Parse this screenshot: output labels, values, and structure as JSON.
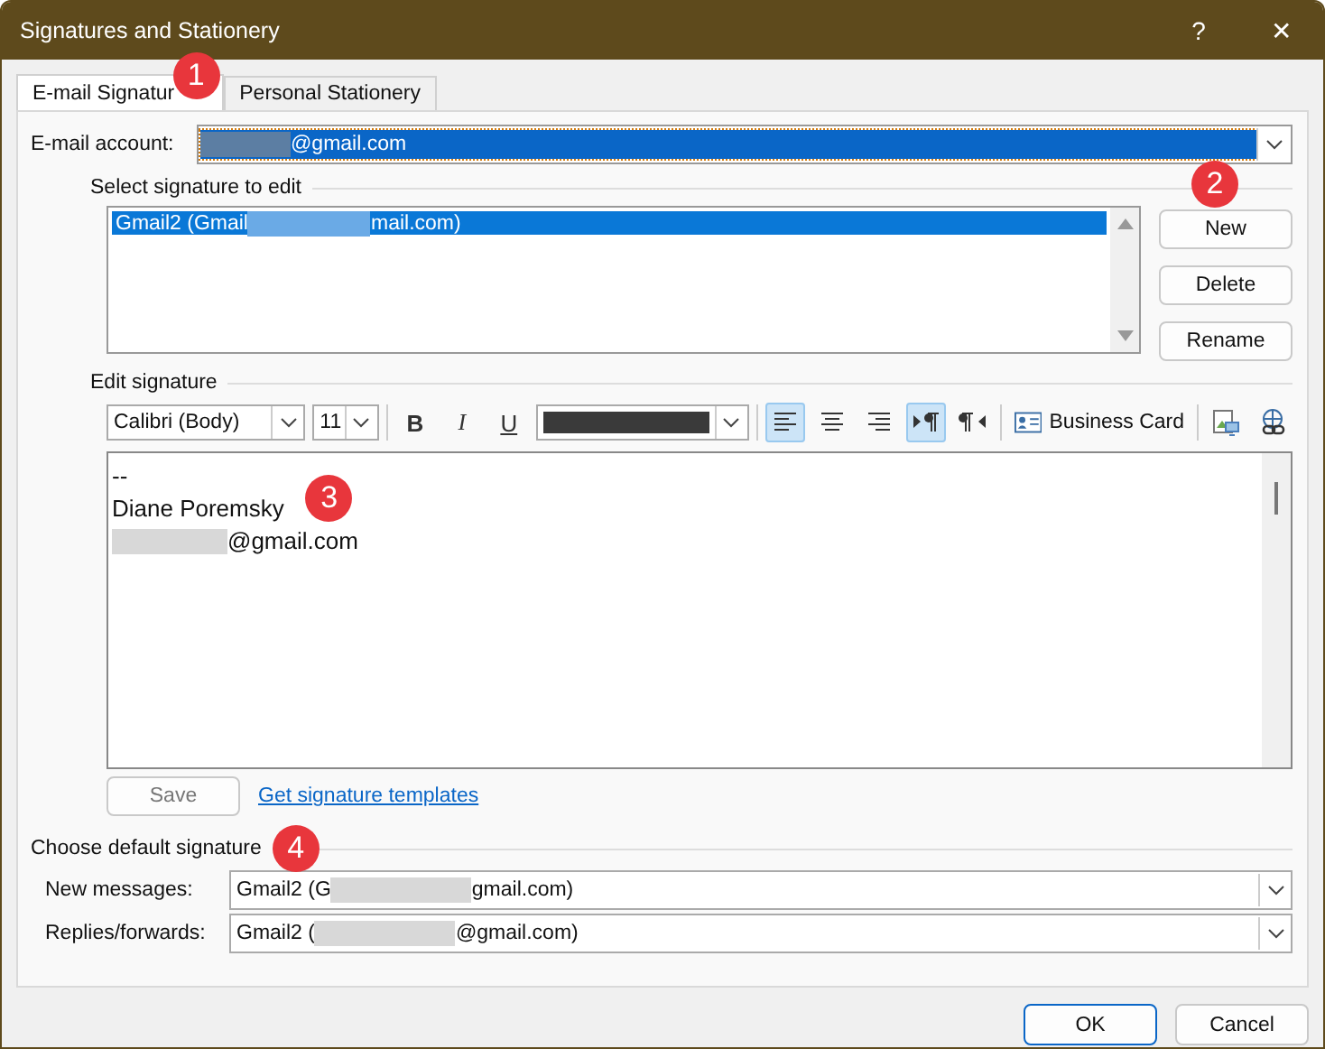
{
  "window": {
    "title": "Signatures and Stationery",
    "controls": [
      "?",
      "✕"
    ]
  },
  "tabs": [
    {
      "label": "E-mail Signatur",
      "selected": true
    },
    {
      "label": "Personal Stationery",
      "selected": false
    }
  ],
  "email_account": {
    "label": "E-mail account:",
    "value_after_redaction": "@gmail.com",
    "focused": true
  },
  "select_signature": {
    "heading": "Select signature to edit",
    "items": [
      {
        "before": "Gmail2 (Gmail",
        "after": "mail.com)",
        "selected": true
      }
    ],
    "buttons": [
      {
        "label": "New",
        "disabled": false
      },
      {
        "label": "Delete",
        "disabled": false
      },
      {
        "label": "Rename",
        "disabled": false
      }
    ]
  },
  "edit_signature": {
    "heading": "Edit signature",
    "toolbar": [
      {
        "kind": "combo",
        "value": "Calibri (Body)"
      },
      {
        "kind": "combo",
        "value": "11"
      },
      {
        "kind": "sep"
      },
      {
        "kind": "toggle",
        "label": "B",
        "selected": false
      },
      {
        "kind": "toggle",
        "label": "I",
        "selected": false
      },
      {
        "kind": "toggle",
        "label": "U",
        "selected": false
      },
      {
        "kind": "color",
        "color": "#3a3a3a"
      },
      {
        "kind": "sep"
      },
      {
        "kind": "icon",
        "selected": true
      },
      {
        "kind": "icon",
        "selected": false
      },
      {
        "kind": "icon",
        "selected": false
      },
      {
        "kind": "icon",
        "selected": true
      },
      {
        "kind": "icon",
        "selected": false
      },
      {
        "kind": "sep"
      },
      {
        "kind": "card",
        "label": "Business Card"
      },
      {
        "kind": "sep"
      },
      {
        "kind": "icon",
        "selected": false
      },
      {
        "kind": "icon",
        "selected": false
      }
    ],
    "body": [
      {
        "text": "--",
        "redacted": false
      },
      {
        "text": "Diane Poremsky",
        "redacted": false
      },
      {
        "text": "@gmail.com",
        "redacted": true
      }
    ],
    "save": {
      "label": "Save",
      "disabled": true
    },
    "link": "Get signature templates"
  },
  "default_signature": {
    "heading": "Choose default signature",
    "rows": [
      {
        "label": "New messages:",
        "before": "Gmail2 (G",
        "after": "gmail.com)"
      },
      {
        "label": "Replies/forwards:",
        "before": "Gmail2 (",
        "after": "@gmail.com)"
      }
    ]
  },
  "callouts": [
    {
      "label": "1"
    },
    {
      "label": "2"
    },
    {
      "label": "3"
    },
    {
      "label": "4"
    }
  ],
  "buttons": [
    {
      "label": "OK",
      "default": true
    },
    {
      "label": "Cancel",
      "default": false
    }
  ]
}
